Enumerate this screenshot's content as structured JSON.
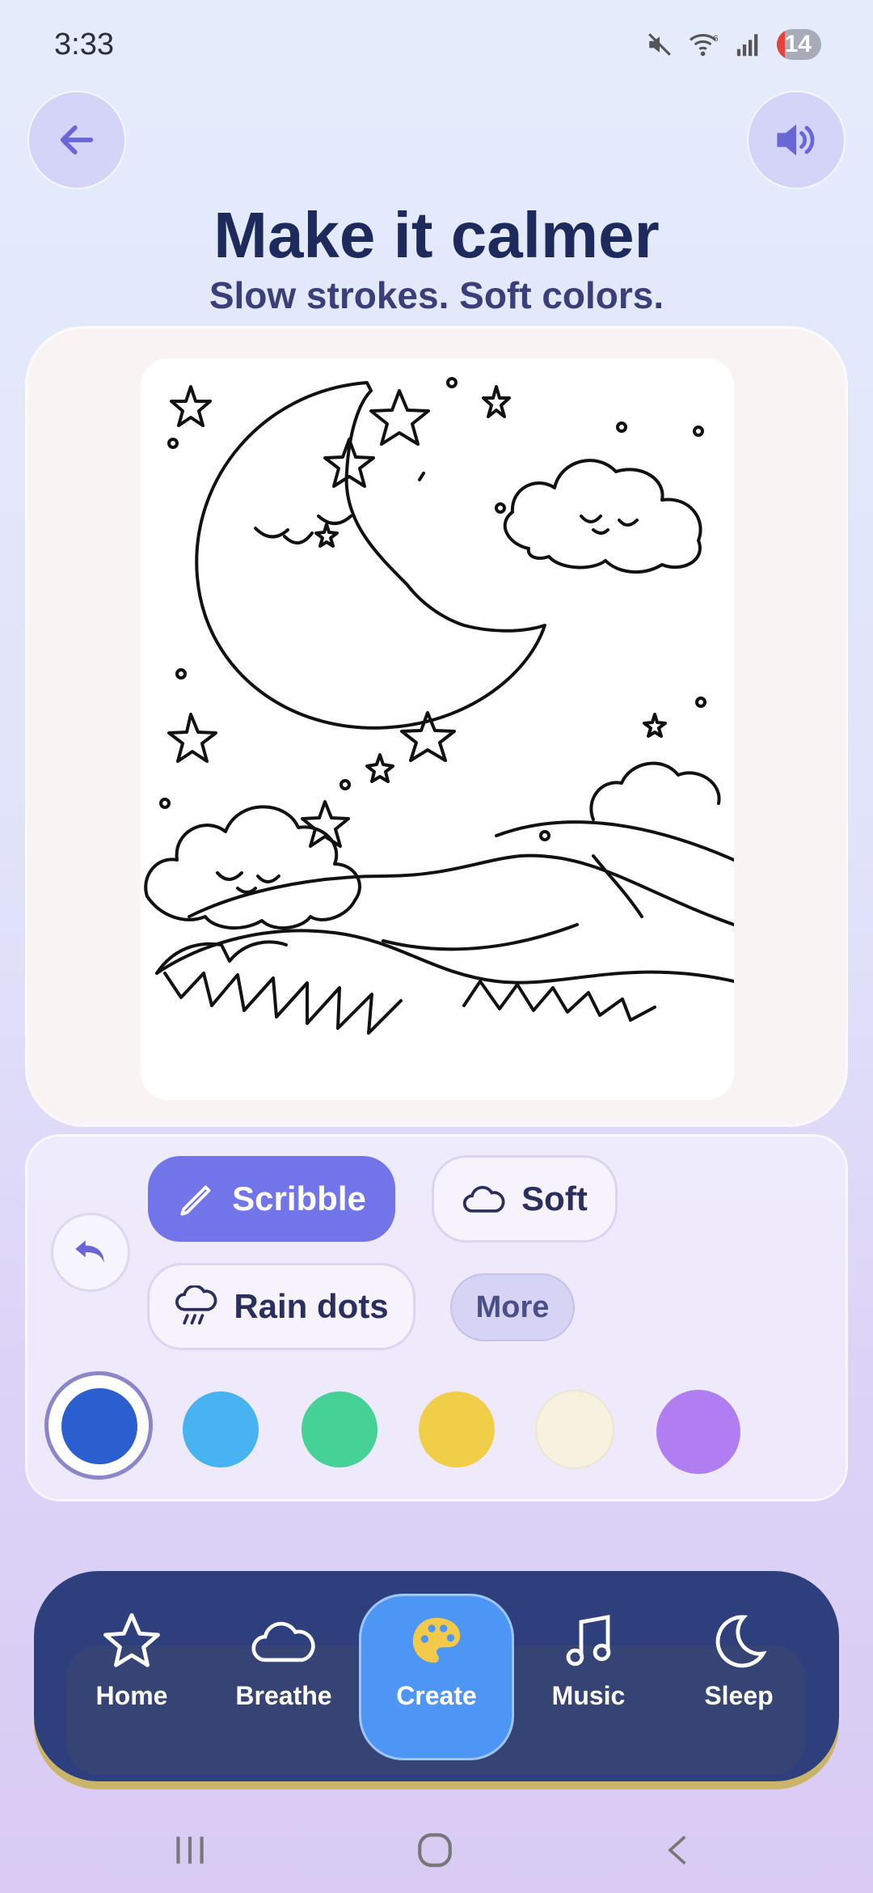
{
  "status": {
    "time": "3:33",
    "battery": "14",
    "icons": [
      "mute-icon",
      "wifi-icon",
      "signal-icon"
    ]
  },
  "header": {
    "back_icon": "arrow-left-icon",
    "sound_icon": "speaker-icon",
    "title": "Make it calmer",
    "subtitle": "Slow strokes. Soft colors."
  },
  "canvas": {
    "image": "coloring-page-sleeping-moon-clouds-stars"
  },
  "tools": {
    "undo_icon": "undo-icon",
    "brushes": [
      {
        "label": "Scribble",
        "icon": "pencil-icon",
        "active": true
      },
      {
        "label": "Soft",
        "icon": "cloud-icon",
        "active": false
      },
      {
        "label": "Rain dots",
        "icon": "rain-cloud-icon",
        "active": false
      }
    ],
    "more_label": "More",
    "colors": [
      "#2b5fcf",
      "#47b4f1",
      "#46d196",
      "#f0ce48",
      "#f7f2e0",
      "#b07ef0"
    ],
    "selected_color": "#2b5fcf"
  },
  "nav": {
    "items": [
      {
        "label": "Home",
        "icon": "star-icon"
      },
      {
        "label": "Breathe",
        "icon": "cloud-icon"
      },
      {
        "label": "Create",
        "icon": "palette-icon",
        "active": true
      },
      {
        "label": "Music",
        "icon": "music-note-icon"
      },
      {
        "label": "Sleep",
        "icon": "moon-icon"
      }
    ]
  },
  "colors": {
    "accent": "#7274ea",
    "nav_bg": "#2d3f7c",
    "nav_active": "#4d96f6",
    "title": "#1f2a5c"
  }
}
